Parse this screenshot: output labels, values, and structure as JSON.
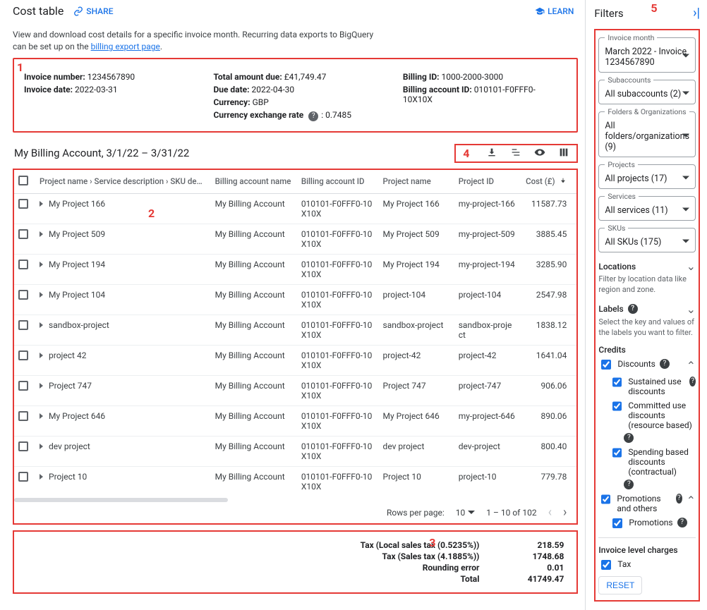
{
  "header": {
    "title": "Cost table",
    "share": "SHARE",
    "learn": "LEARN"
  },
  "intro": {
    "line": "View and download cost details for a specific invoice month. Recurring data exports to BigQuery can be set up on the ",
    "link": "billing export page",
    "tail": "."
  },
  "summary": {
    "invoice_number_lbl": "Invoice number:",
    "invoice_number": "1234567890",
    "invoice_date_lbl": "Invoice date:",
    "invoice_date": "2022-03-31",
    "total_due_lbl": "Total amount due:",
    "total_due": "£41,749.47",
    "due_date_lbl": "Due date:",
    "due_date": "2022-04-30",
    "currency_lbl": "Currency:",
    "currency": "GBP",
    "fx_lbl": "Currency exchange rate",
    "fx": "0.7485",
    "billing_id_lbl": "Billing ID:",
    "billing_id": "1000-2000-3000",
    "billing_acct_lbl": "Billing account ID:",
    "billing_acct": "010101-F0FFF0-10X10X"
  },
  "account_range": "My Billing Account, 3/1/22 – 3/31/22",
  "callouts": {
    "one": "1",
    "two": "2",
    "three": "3",
    "four": "4",
    "five": "5"
  },
  "columns": {
    "hierarchy": "Project name › Service description › SKU description",
    "ban": "Billing account name",
    "baid": "Billing account ID",
    "pname": "Project name",
    "pid": "Project ID",
    "cost": "Cost (£)"
  },
  "rows": [
    {
      "proj": "My Project 166",
      "ban": "My Billing Account",
      "baid": "010101-F0FFF0-10X10X",
      "pname": "My Project 166",
      "pid": "my-project-166",
      "cost": "11587.73"
    },
    {
      "proj": "My Project 509",
      "ban": "My Billing Account",
      "baid": "010101-F0FFF0-10X10X",
      "pname": "My Project 509",
      "pid": "my-project-509",
      "cost": "3885.45"
    },
    {
      "proj": "My Project 194",
      "ban": "My Billing Account",
      "baid": "010101-F0FFF0-10X10X",
      "pname": "My Project 194",
      "pid": "my-project-194",
      "cost": "3285.90"
    },
    {
      "proj": "My Project 104",
      "ban": "My Billing Account",
      "baid": "010101-F0FFF0-10X10X",
      "pname": "project-104",
      "pid": "project-104",
      "cost": "2547.98"
    },
    {
      "proj": "sandbox-project",
      "ban": "My Billing Account",
      "baid": "010101-F0FFF0-10X10X",
      "pname": "sandbox-project",
      "pid": "sandbox-project",
      "cost": "1838.12"
    },
    {
      "proj": "project 42",
      "ban": "My Billing Account",
      "baid": "010101-F0FFF0-10X10X",
      "pname": "project-42",
      "pid": "project-42",
      "cost": "1641.04"
    },
    {
      "proj": "Project 747",
      "ban": "My Billing Account",
      "baid": "010101-F0FFF0-10X10X",
      "pname": "Project 747",
      "pid": "project-747",
      "cost": "906.06"
    },
    {
      "proj": "My Project 646",
      "ban": "My Billing Account",
      "baid": "010101-F0FFF0-10X10X",
      "pname": "My Project 646",
      "pid": "my-project-646",
      "cost": "890.06"
    },
    {
      "proj": "dev project",
      "ban": "My Billing Account",
      "baid": "010101-F0FFF0-10X10X",
      "pname": "dev project",
      "pid": "dev-project",
      "cost": "800.40"
    },
    {
      "proj": "Project 10",
      "ban": "My Billing Account",
      "baid": "010101-F0FFF0-10X10X",
      "pname": "Project 10",
      "pid": "project-10",
      "cost": "779.78"
    }
  ],
  "pager": {
    "rpp_label": "Rows per page:",
    "rpp_value": "10",
    "range": "1 – 10 of 102"
  },
  "totals": {
    "l1_lbl": "Tax (Local sales tax (0.5235%))",
    "l1_amt": "218.59",
    "l2_lbl": "Tax (Sales tax (4.1885%))",
    "l2_amt": "1748.68",
    "l3_lbl": "Rounding error",
    "l3_amt": "0.01",
    "l4_lbl": "Total",
    "l4_amt": "41749.47"
  },
  "filters": {
    "title": "Filters",
    "month_hdr": "Invoice month",
    "month_val": "March 2022 - Invoice 1234567890",
    "subacct_hdr": "Subaccounts",
    "subacct_val": "All subaccounts (2)",
    "folders_hdr": "Folders & Organizations",
    "folders_val": "All folders/organizations (9)",
    "projects_hdr": "Projects",
    "projects_val": "All projects (17)",
    "services_hdr": "Services",
    "services_val": "All services (11)",
    "skus_hdr": "SKUs",
    "skus_val": "All SKUs (175)",
    "locations_title": "Locations",
    "locations_sub": "Filter by location data like region and zone.",
    "labels_title": "Labels",
    "labels_sub": "Select the key and values of the labels you want to filter.",
    "credits_title": "Credits",
    "discounts": "Discounts",
    "sud": "Sustained use discounts",
    "cud": "Committed use discounts (resource based)",
    "sbd": "Spending based discounts (contractual)",
    "promo": "Promotions and others",
    "promo2": "Promotions",
    "invlvl": "Invoice level charges",
    "tax": "Tax",
    "reset": "RESET"
  }
}
